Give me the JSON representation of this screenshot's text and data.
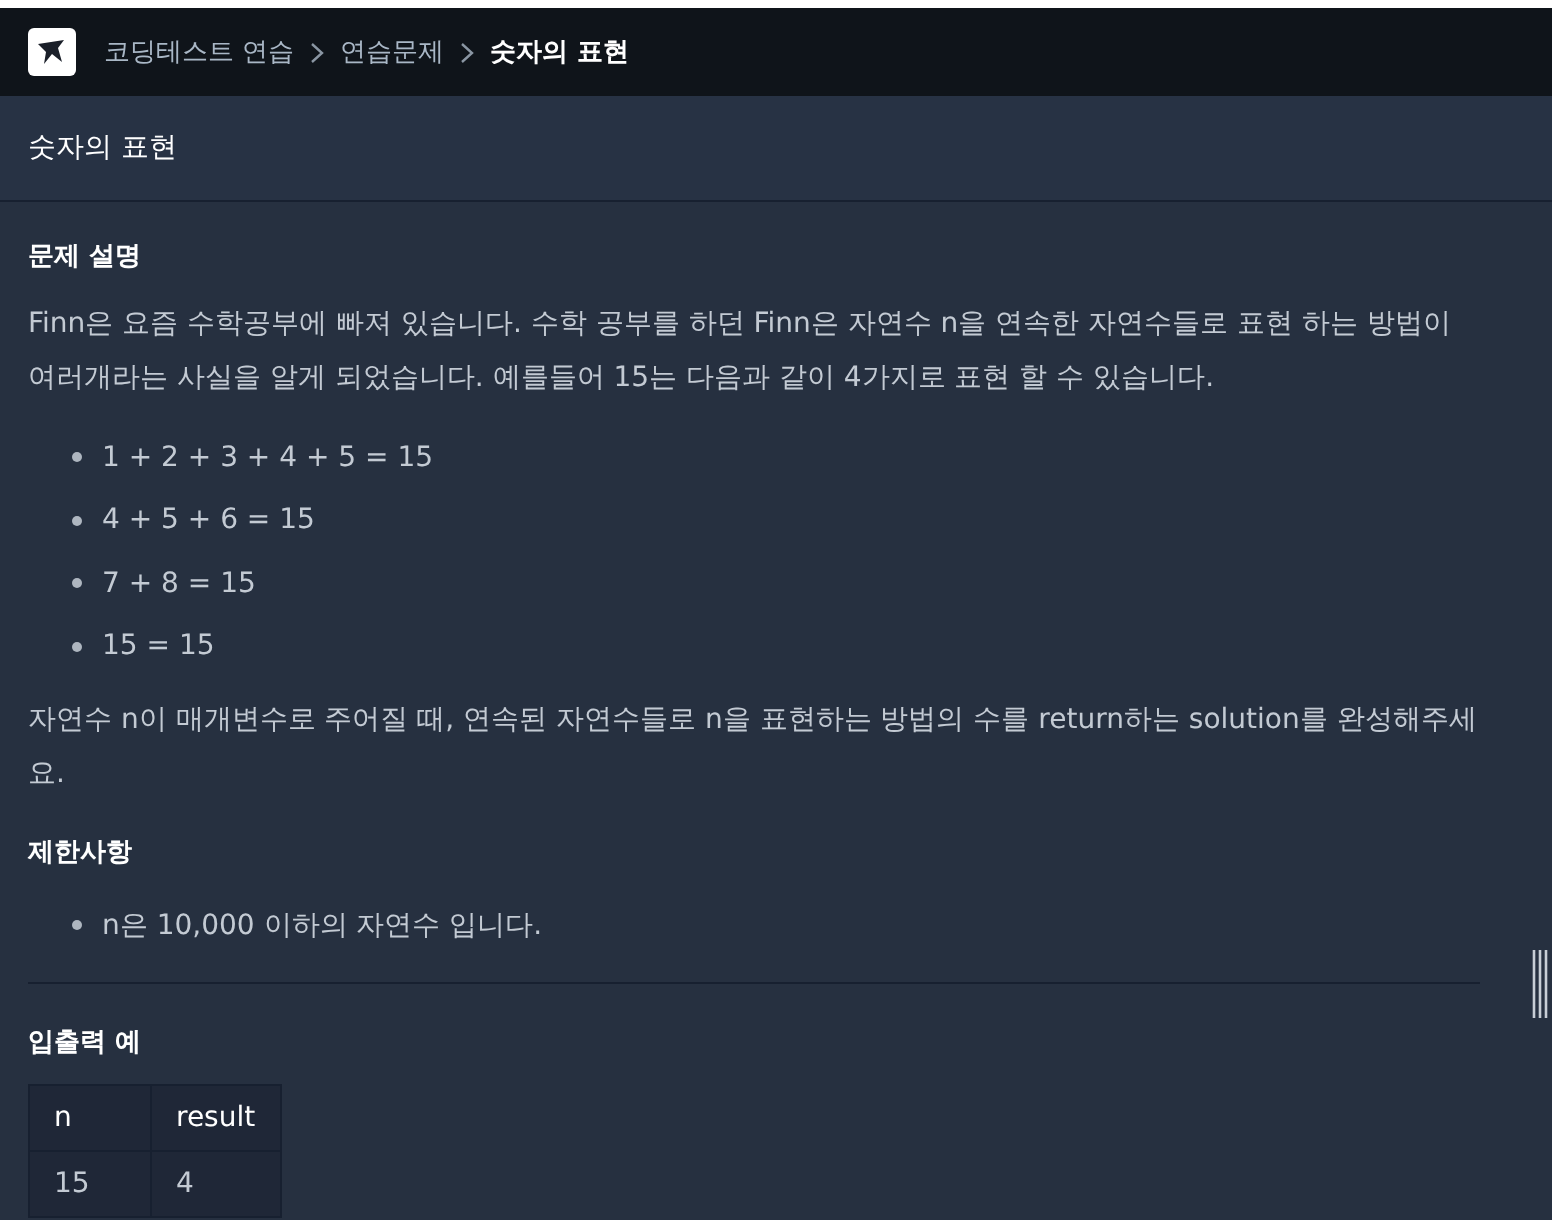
{
  "breadcrumb": [
    {
      "label": "코딩테스트 연습",
      "selected": false
    },
    {
      "label": "연습문제",
      "selected": false
    },
    {
      "label": "숫자의 표현",
      "selected": true
    }
  ],
  "title": "숫자의 표현",
  "sections": [
    {
      "kind": "text",
      "heading": "문제 설명",
      "paragraphs": [
        "Finn은 요즘 수학공부에 빠져 있습니다. 수학 공부를 하던 Finn은 자연수 n을 연속한 자연수들로 표현 하는 방법이 여러개라는 사실을 알게 되었습니다. 예를들어 15는 다음과 같이 4가지로 표현 할 수 있습니다."
      ],
      "bullets": [
        "1 + 2 + 3 + 4 + 5 = 15",
        "4 + 5 + 6 = 15",
        "7 + 8 = 15",
        "15 = 15"
      ],
      "after": "자연수 n이 매개변수로 주어질 때, 연속된 자연수들로 n을 표현하는 방법의 수를 return하는 solution를 완성해주세요."
    },
    {
      "kind": "list",
      "heading": "제한사항",
      "bullets": [
        "n은 10,000 이하의 자연수 입니다."
      ]
    },
    {
      "kind": "table",
      "heading": "입출력 예",
      "columns": [
        "n",
        "result"
      ],
      "rows": [
        [
          "15",
          "4"
        ]
      ]
    }
  ]
}
